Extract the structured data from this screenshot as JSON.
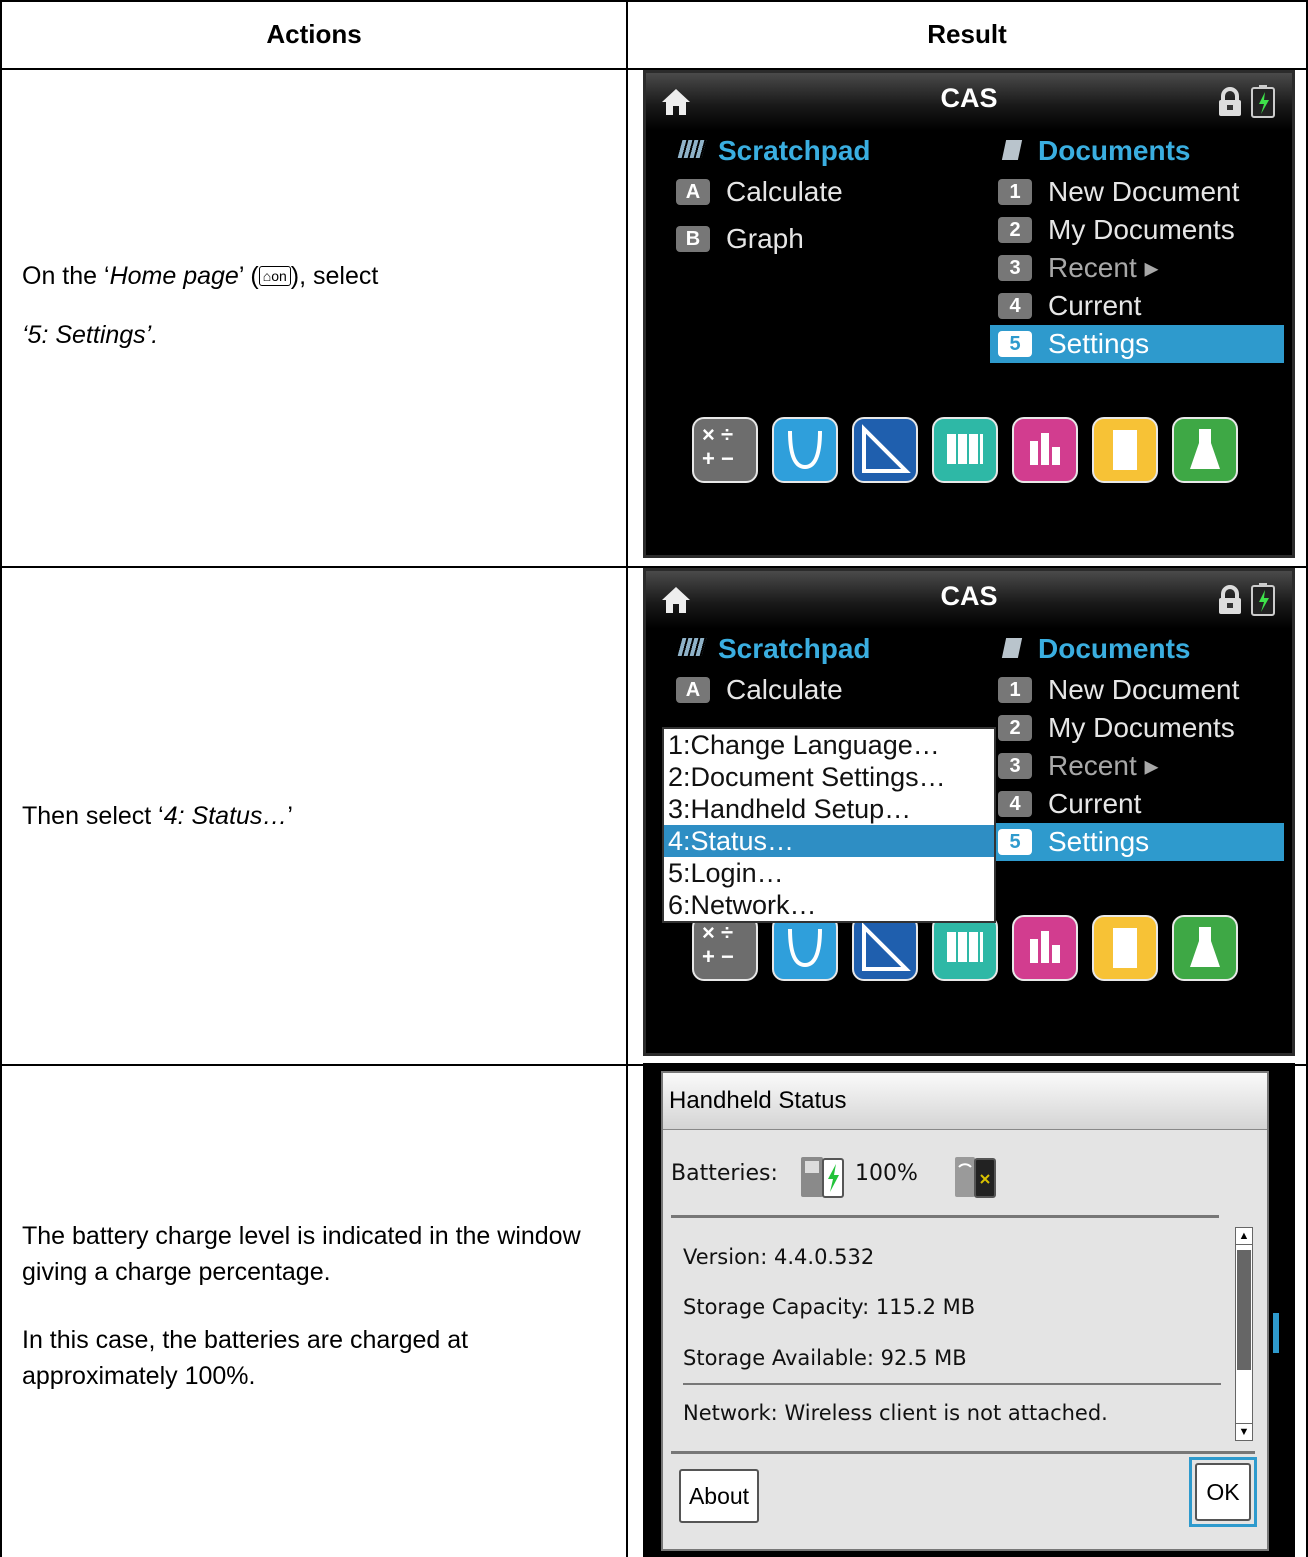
{
  "table": {
    "header_actions": "Actions",
    "header_result": "Result"
  },
  "rows": [
    {
      "action_line1_prefix": "On the ‘",
      "action_line1_italic": "Home page",
      "action_line1_suffix": "’ (",
      "action_key_label": "on",
      "action_line1_end": "), select",
      "action_line2": "‘5: Settings’."
    },
    {
      "action_prefix": "Then select ‘",
      "action_italic": "4: Status…",
      "action_suffix": "’"
    },
    {
      "action_para1": "The battery charge level is indicated in the window giving a charge percentage.",
      "action_para2": "In this case, the batteries are charged at approximately 100%."
    }
  ],
  "home_screen": {
    "title": "CAS",
    "scratchpad": {
      "heading": "Scratchpad",
      "items": [
        {
          "key": "A",
          "label": "Calculate"
        },
        {
          "key": "B",
          "label": "Graph"
        }
      ]
    },
    "documents": {
      "heading": "Documents",
      "items": [
        {
          "key": "1",
          "label": "New Document"
        },
        {
          "key": "2",
          "label": "My Documents"
        },
        {
          "key": "3",
          "label": "Recent ▸"
        },
        {
          "key": "4",
          "label": "Current"
        },
        {
          "key": "5",
          "label": "Settings"
        }
      ]
    },
    "apps": [
      "calculator-app-icon",
      "graphs-app-icon",
      "geometry-app-icon",
      "lists-spreadsheet-app-icon",
      "data-statistics-app-icon",
      "notes-app-icon",
      "vernier-dataquest-app-icon"
    ]
  },
  "settings_menu": {
    "items": [
      "1:Change Language…",
      "2:Document Settings…",
      "3:Handheld Setup…",
      "4:Status…",
      "5:Login…",
      "6:Network…"
    ],
    "selected_index": 3
  },
  "status_dialog": {
    "title": "Handheld Status",
    "batteries_label": "Batteries:",
    "batteries_value": "100%",
    "version_label": "Version:",
    "version_value": "4.4.0.532",
    "capacity_label": "Storage Capacity:",
    "capacity_value": "115.2 MB",
    "available_label": "Storage Available:",
    "available_value": "92.5 MB",
    "network_label": "Network:",
    "network_value": "Wireless client is not attached.",
    "about_button": "About",
    "ok_button": "OK"
  },
  "colors": {
    "highlight_blue": "#2e9acd",
    "heading_blue": "#3aaee0",
    "screen_bg": "#000000"
  }
}
